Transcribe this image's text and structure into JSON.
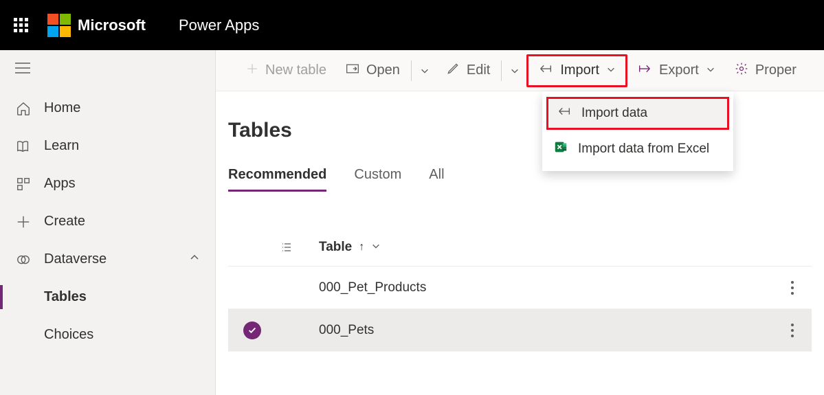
{
  "header": {
    "brand": "Microsoft",
    "app": "Power Apps"
  },
  "sidebar": {
    "items": [
      {
        "label": "Home"
      },
      {
        "label": "Learn"
      },
      {
        "label": "Apps"
      },
      {
        "label": "Create"
      },
      {
        "label": "Dataverse"
      }
    ],
    "sub": [
      {
        "label": "Tables",
        "selected": true
      },
      {
        "label": "Choices",
        "selected": false
      }
    ]
  },
  "commands": {
    "new_table": "New table",
    "open": "Open",
    "edit": "Edit",
    "import": "Import",
    "export": "Export",
    "properties": "Proper"
  },
  "import_menu": {
    "import_data": "Import data",
    "import_excel": "Import data from Excel"
  },
  "page": {
    "title": "Tables"
  },
  "tabs": [
    {
      "label": "Recommended",
      "active": true
    },
    {
      "label": "Custom",
      "active": false
    },
    {
      "label": "All",
      "active": false
    }
  ],
  "table": {
    "col_name": "Table",
    "rows": [
      {
        "name": "000_Pet_Products",
        "selected": false
      },
      {
        "name": "000_Pets",
        "selected": true
      }
    ]
  }
}
